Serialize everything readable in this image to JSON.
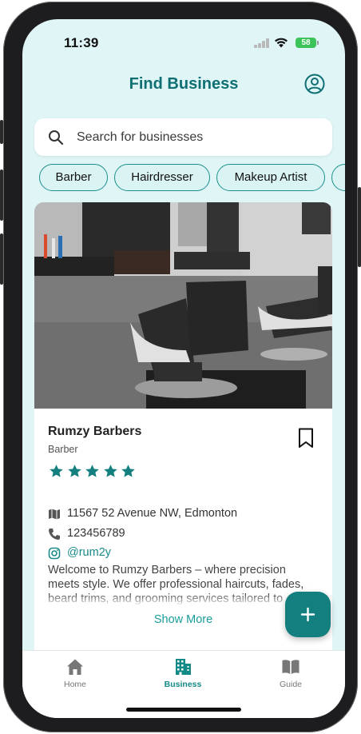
{
  "status_bar": {
    "time": "11:39",
    "battery": "58"
  },
  "header": {
    "title": "Find Business"
  },
  "search": {
    "placeholder": "Search for businesses"
  },
  "chips": [
    "Barber",
    "Hairdresser",
    "Makeup Artist"
  ],
  "business": {
    "name": "Rumzy Barbers",
    "category": "Barber",
    "rating": 5,
    "address": "11567 52 Avenue NW, Edmonton",
    "phone": "123456789",
    "instagram": "@rum2y",
    "description": "Welcome to Rumzy Barbers – where precision meets style. We offer professional haircuts, fades, beard trims, and grooming services tailored to",
    "show_more": "Show More"
  },
  "tabs": [
    {
      "label": "Home",
      "icon": "home-icon",
      "active": false
    },
    {
      "label": "Business",
      "icon": "building-icon",
      "active": true
    },
    {
      "label": "Guide",
      "icon": "book-icon",
      "active": false
    }
  ],
  "colors": {
    "accent": "#137f7e",
    "title": "#0f6f72",
    "background": "#dff5f6",
    "star": "#137f7e"
  }
}
